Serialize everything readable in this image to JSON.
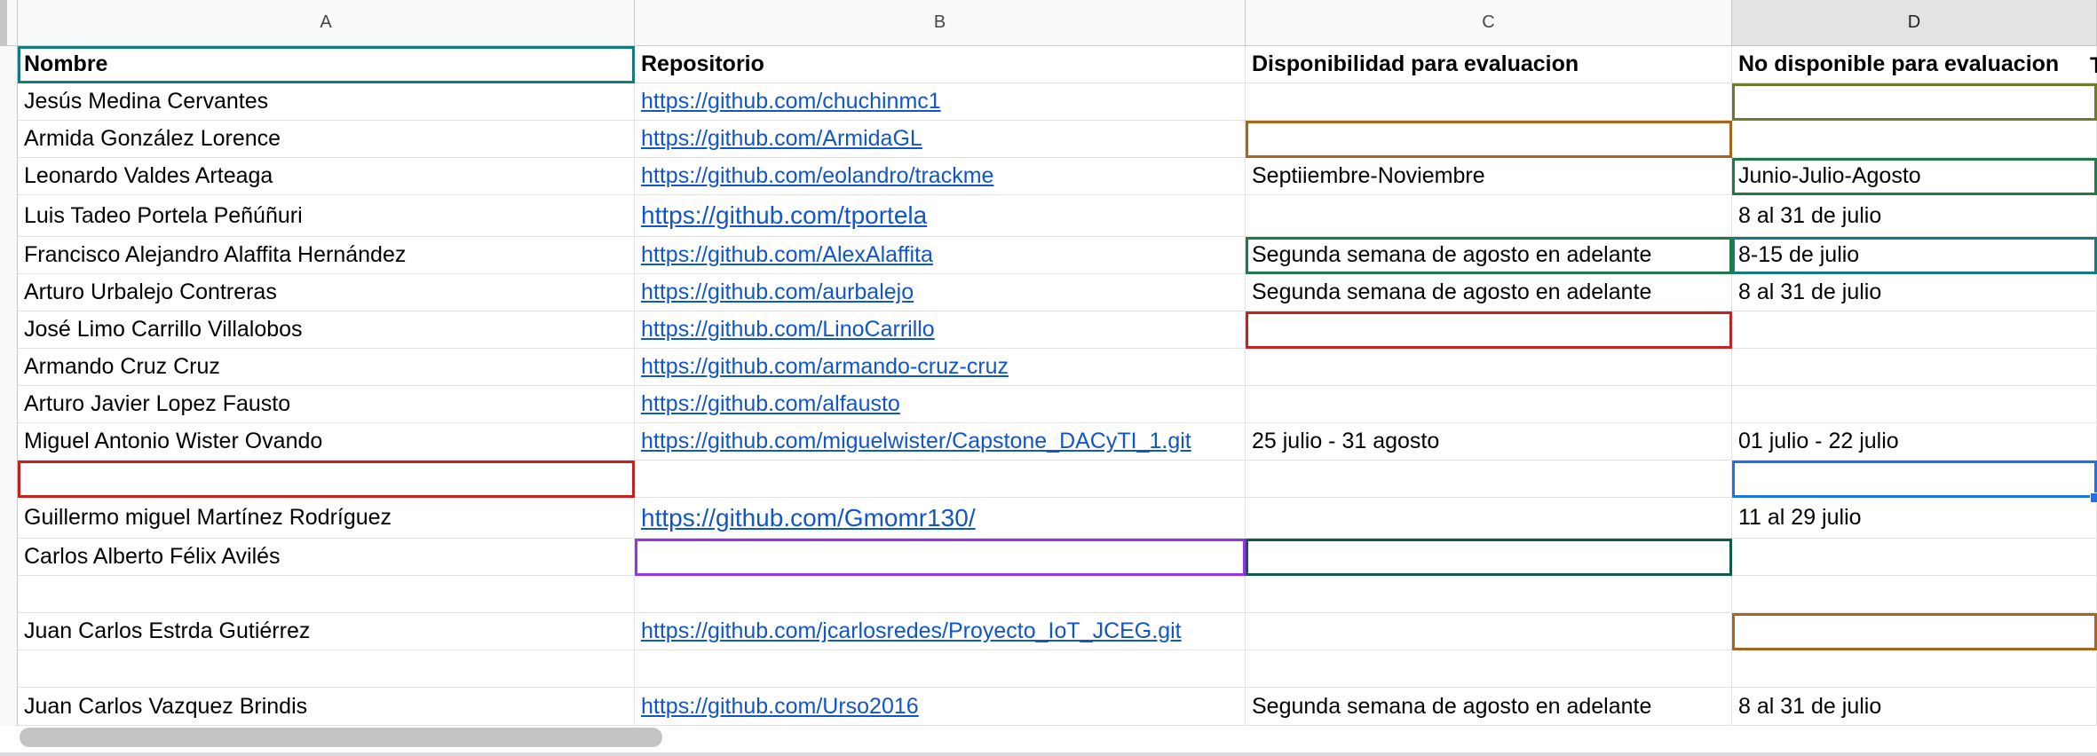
{
  "columns": [
    "A",
    "B",
    "C",
    "D"
  ],
  "header": [
    "Nombre",
    "Repositorio",
    "Disponibilidad para evaluacion",
    "No disponible para evaluacion"
  ],
  "clipped_next_header": "T",
  "rows": [
    [
      "Jesús Medina Cervantes",
      "https://github.com/chuchinmc1",
      "",
      ""
    ],
    [
      "Armida González Lorence",
      "https://github.com/ArmidaGL",
      "",
      ""
    ],
    [
      "Leonardo Valdes Arteaga",
      "https://github.com/eolandro/trackme",
      "Septiiembre-Noviembre",
      "Junio-Julio-Agosto"
    ],
    [
      "Luis Tadeo Portela Peñúñuri",
      "https://github.com/tportela",
      "",
      "8 al 31 de julio"
    ],
    [
      "Francisco Alejandro Alaffita Hernández",
      "https://github.com/AlexAlaffita",
      "Segunda semana de agosto en adelante",
      "8-15 de julio"
    ],
    [
      "Arturo Urbalejo Contreras",
      "https://github.com/aurbalejo",
      "Segunda semana de agosto en adelante",
      "8 al 31 de julio"
    ],
    [
      "José Limo Carrillo Villalobos",
      "https://github.com/LinoCarrillo",
      "",
      ""
    ],
    [
      "Armando Cruz Cruz",
      "https://github.com/armando-cruz-cruz",
      "",
      ""
    ],
    [
      "Arturo Javier Lopez Fausto",
      "https://github.com/alfausto",
      "",
      ""
    ],
    [
      "Miguel Antonio Wister Ovando",
      "https://github.com/miguelwister/Capstone_DACyTI_1.git",
      "25 julio - 31 agosto",
      "01 julio -  22 julio"
    ],
    [
      "",
      "",
      "",
      ""
    ],
    [
      "Guillermo miguel Martínez Rodríguez",
      "https://github.com/Gmomr130/",
      "",
      "11 al 29 julio"
    ],
    [
      "Carlos Alberto Félix Avilés",
      "",
      "",
      ""
    ],
    [
      "",
      "",
      "",
      ""
    ],
    [
      "Juan Carlos Estrda Gutiérrez",
      "https://github.com/jcarlosredes/Proyecto_IoT_JCEG.git",
      "",
      ""
    ],
    [
      "",
      "",
      "",
      ""
    ],
    [
      "Juan Carlos Vazquez Brindis",
      "https://github.com/Urso2016",
      "Segunda semana de agosto en adelante",
      "8 al 31 de julio"
    ]
  ],
  "colors": {
    "teal": "#137a7f",
    "olive": "#6b7a2c",
    "brown": "#a8651c",
    "green": "#1e7a46",
    "red": "#c5221f",
    "blue": "#1a73e8",
    "purple": "#9334e6",
    "darkgreen": "#0d5c4a",
    "link": "#1155cc"
  },
  "collaborator_cursors": [
    {
      "row": 0,
      "col": 0,
      "color": "teal"
    },
    {
      "row": 1,
      "col": 3,
      "color": "olive"
    },
    {
      "row": 2,
      "col": 2,
      "color": "brown"
    },
    {
      "row": 3,
      "col": 3,
      "color": "green"
    },
    {
      "row": 5,
      "col": 2,
      "color": "green"
    },
    {
      "row": 5,
      "col": 3,
      "color": "teal"
    },
    {
      "row": 7,
      "col": 2,
      "color": "red"
    },
    {
      "row": 11,
      "col": 0,
      "color": "red"
    },
    {
      "row": 13,
      "col": 1,
      "color": "purple"
    },
    {
      "row": 13,
      "col": 2,
      "color": "darkgreen"
    },
    {
      "row": 15,
      "col": 3,
      "color": "brown"
    }
  ],
  "selection": {
    "row": 11,
    "col": 3,
    "color": "blue"
  }
}
